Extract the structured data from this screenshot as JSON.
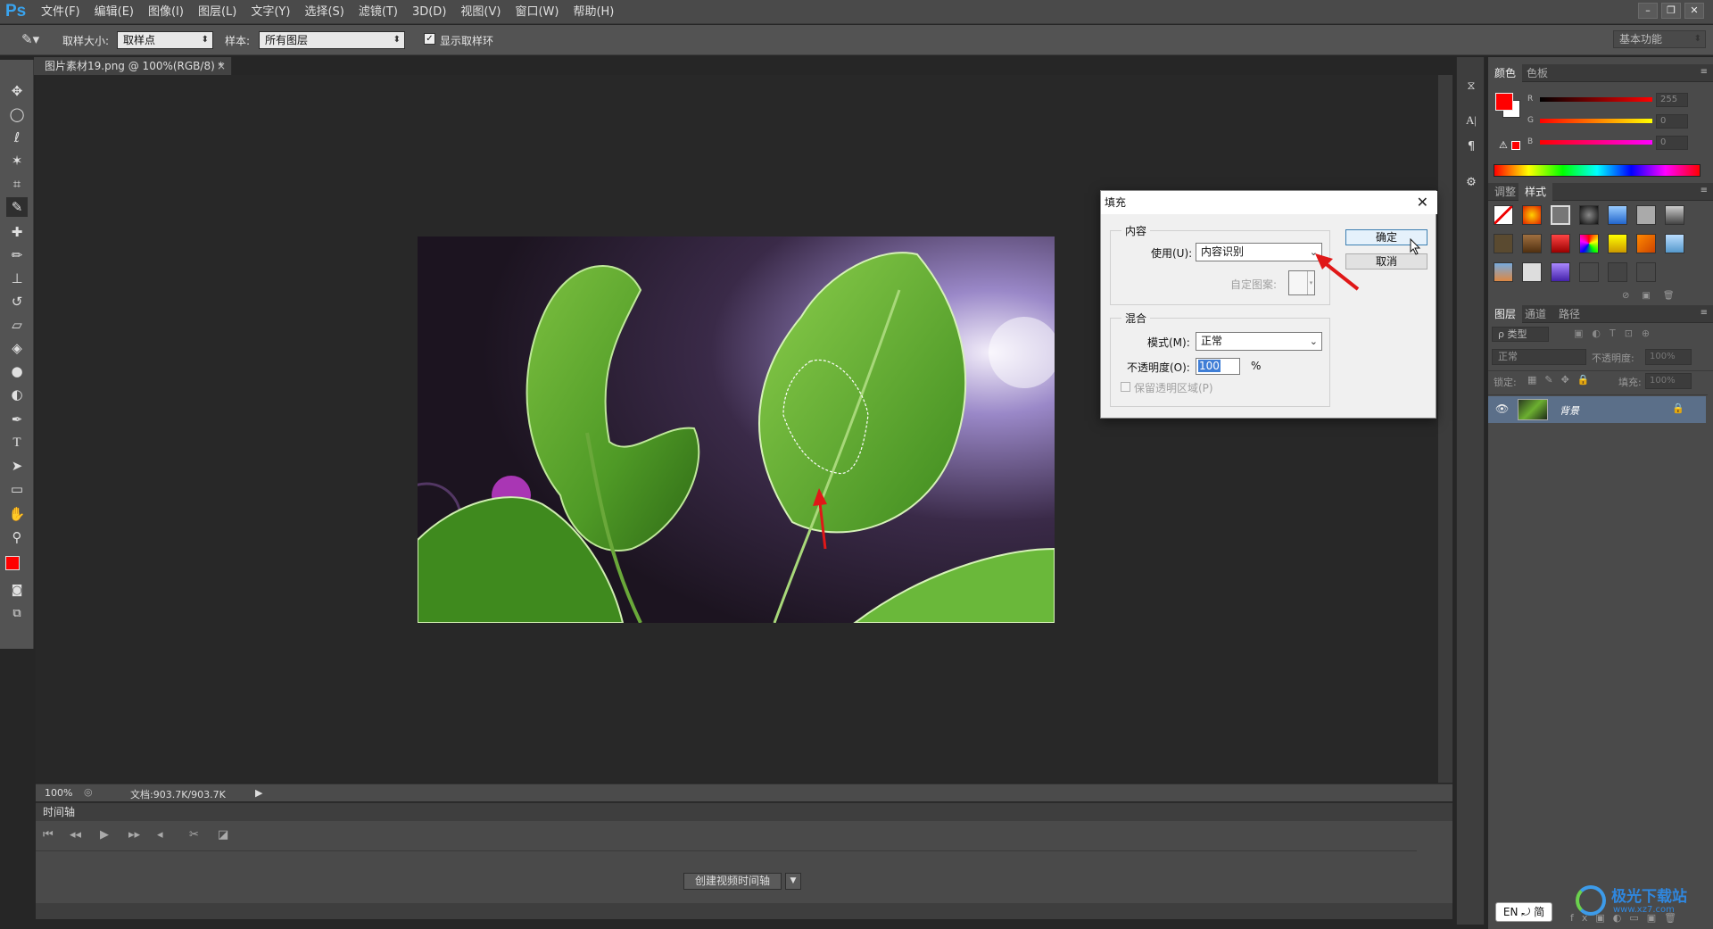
{
  "app": {
    "logo": "Ps"
  },
  "menubar": {
    "items": [
      "文件(F)",
      "编辑(E)",
      "图像(I)",
      "图层(L)",
      "文字(Y)",
      "选择(S)",
      "滤镜(T)",
      "3D(D)",
      "视图(V)",
      "窗口(W)",
      "帮助(H)"
    ]
  },
  "optionsbar": {
    "sample_size_label": "取样大小:",
    "sample_size_value": "取样点",
    "sample_label": "样本:",
    "sample_value": "所有图层",
    "show_ring_label": "显示取样环",
    "show_ring_checked": true,
    "workspace": "基本功能"
  },
  "document": {
    "tab_title": "图片素材19.png @ 100%(RGB/8) *",
    "zoom": "100%",
    "doc_size": "文档:903.7K/903.7K"
  },
  "timeline": {
    "title": "时间轴",
    "create_button": "创建视频时间轴"
  },
  "color_panel": {
    "tabs": [
      "颜色",
      "色板"
    ],
    "channels": [
      {
        "label": "R",
        "value": "255"
      },
      {
        "label": "G",
        "value": "0"
      },
      {
        "label": "B",
        "value": "0"
      }
    ],
    "foreground": "#ff0000",
    "background": "#ffffff"
  },
  "styles_panel": {
    "tabs": [
      "调整",
      "样式"
    ]
  },
  "layers_panel": {
    "tabs": [
      "图层",
      "通道",
      "路径"
    ],
    "filter_label": "ρ 类型",
    "blend_mode": "正常",
    "opacity_label": "不透明度:",
    "opacity_value": "100%",
    "lock_label": "锁定:",
    "fill_label": "填充:",
    "fill_value": "100%",
    "layer_name": "背景"
  },
  "fill_dialog": {
    "title": "填充",
    "contents_group": "内容",
    "use_label": "使用(U):",
    "use_value": "内容识别",
    "custom_pattern_label": "自定图案:",
    "blending_group": "混合",
    "mode_label": "模式(M):",
    "mode_value": "正常",
    "opacity_label": "不透明度(O):",
    "opacity_value": "100",
    "opacity_unit": "%",
    "preserve_label": "保留透明区域(P)",
    "ok_label": "确定",
    "cancel_label": "取消"
  },
  "ime": {
    "text": "EN ⤾ 简"
  },
  "watermark": {
    "text": "极光下载站",
    "url_text": "www.xz7.com"
  }
}
